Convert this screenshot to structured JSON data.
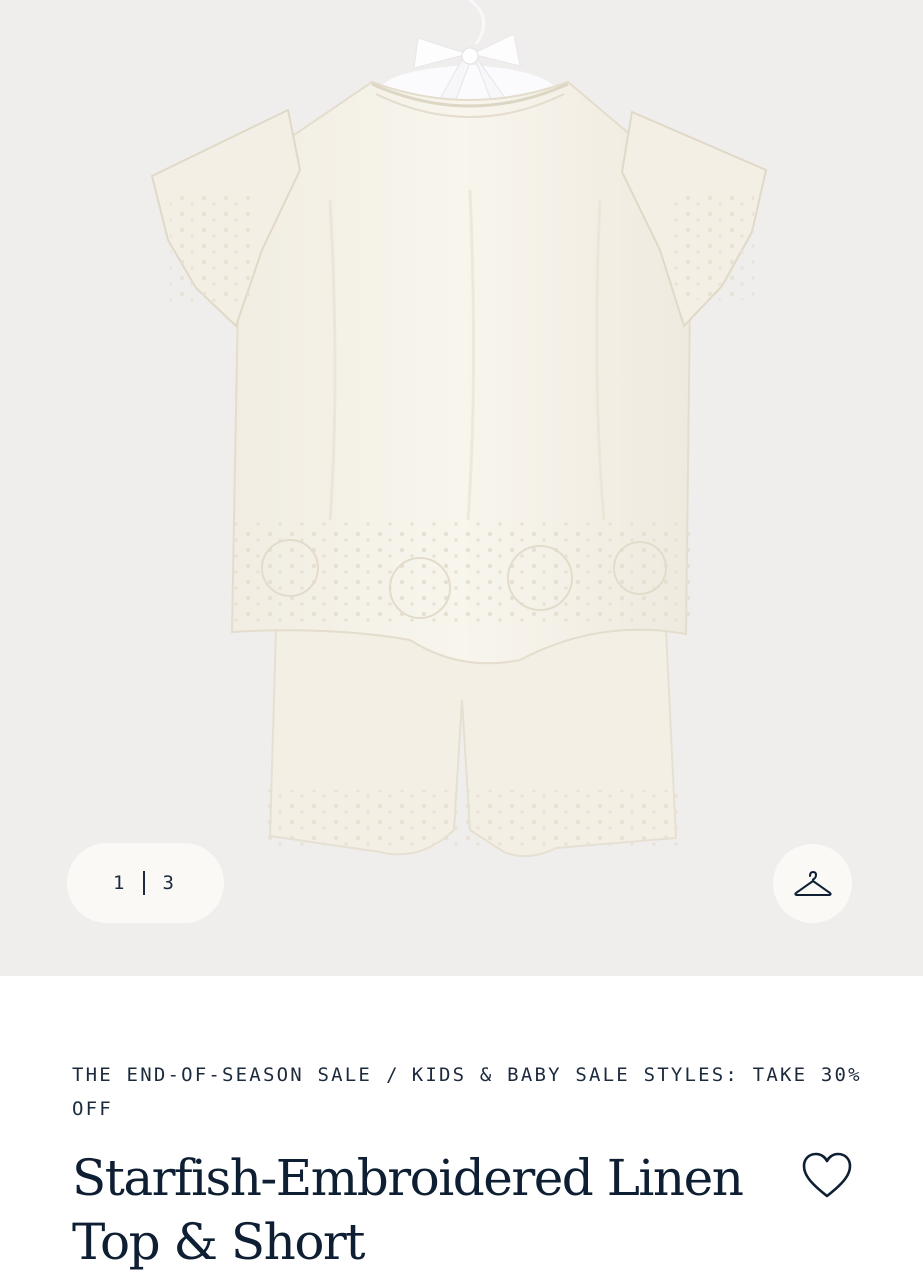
{
  "gallery": {
    "current_index": "1",
    "total": "3",
    "hanger_icon": "hanger-icon"
  },
  "breadcrumb": {
    "items": [
      "THE END-OF-SEASON SALE",
      "KIDS & BABY SALE STYLES: TAKE 30% OFF"
    ],
    "separator": "/"
  },
  "product": {
    "title": "Starfish-Embroidered Linen Top & Short",
    "favorite_icon": "heart-icon"
  },
  "colors": {
    "gallery_background": "#efeeec",
    "garment": "#f5f1e6",
    "text": "#0f1f33"
  }
}
